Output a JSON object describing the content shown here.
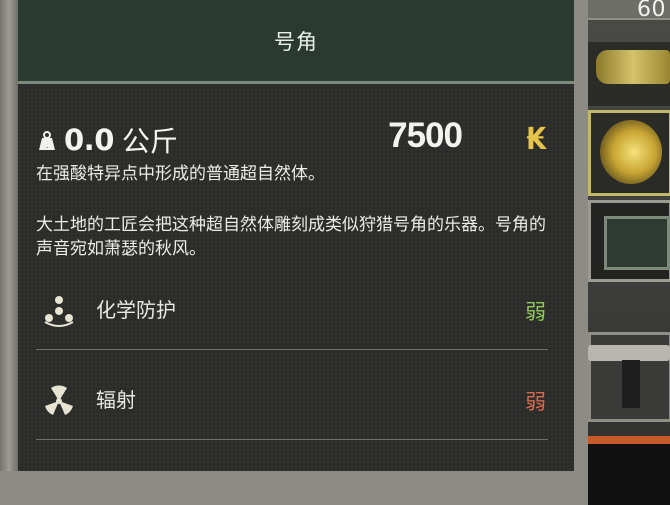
{
  "inventory": {
    "count_label": "60"
  },
  "tooltip": {
    "title": "号角",
    "weight": {
      "value": "0.0",
      "unit": "公斤",
      "icon": "weight-icon"
    },
    "price": {
      "value": "7500",
      "currency_symbol": "₭",
      "currency_color": "#e6c34a"
    },
    "description": [
      "在强酸特异点中形成的普通超自然体。",
      "大土地的工匠会把这种超自然体雕刻成类似狩猎号角的乐器。号角的声音宛如萧瑟的秋风。"
    ],
    "stats": [
      {
        "icon": "chemical-protection-icon",
        "label": "化学防护",
        "value": "弱",
        "value_color": "#8ec95a"
      },
      {
        "icon": "radiation-icon",
        "label": "辐射",
        "value": "弱",
        "value_color": "#d8694b"
      }
    ]
  }
}
